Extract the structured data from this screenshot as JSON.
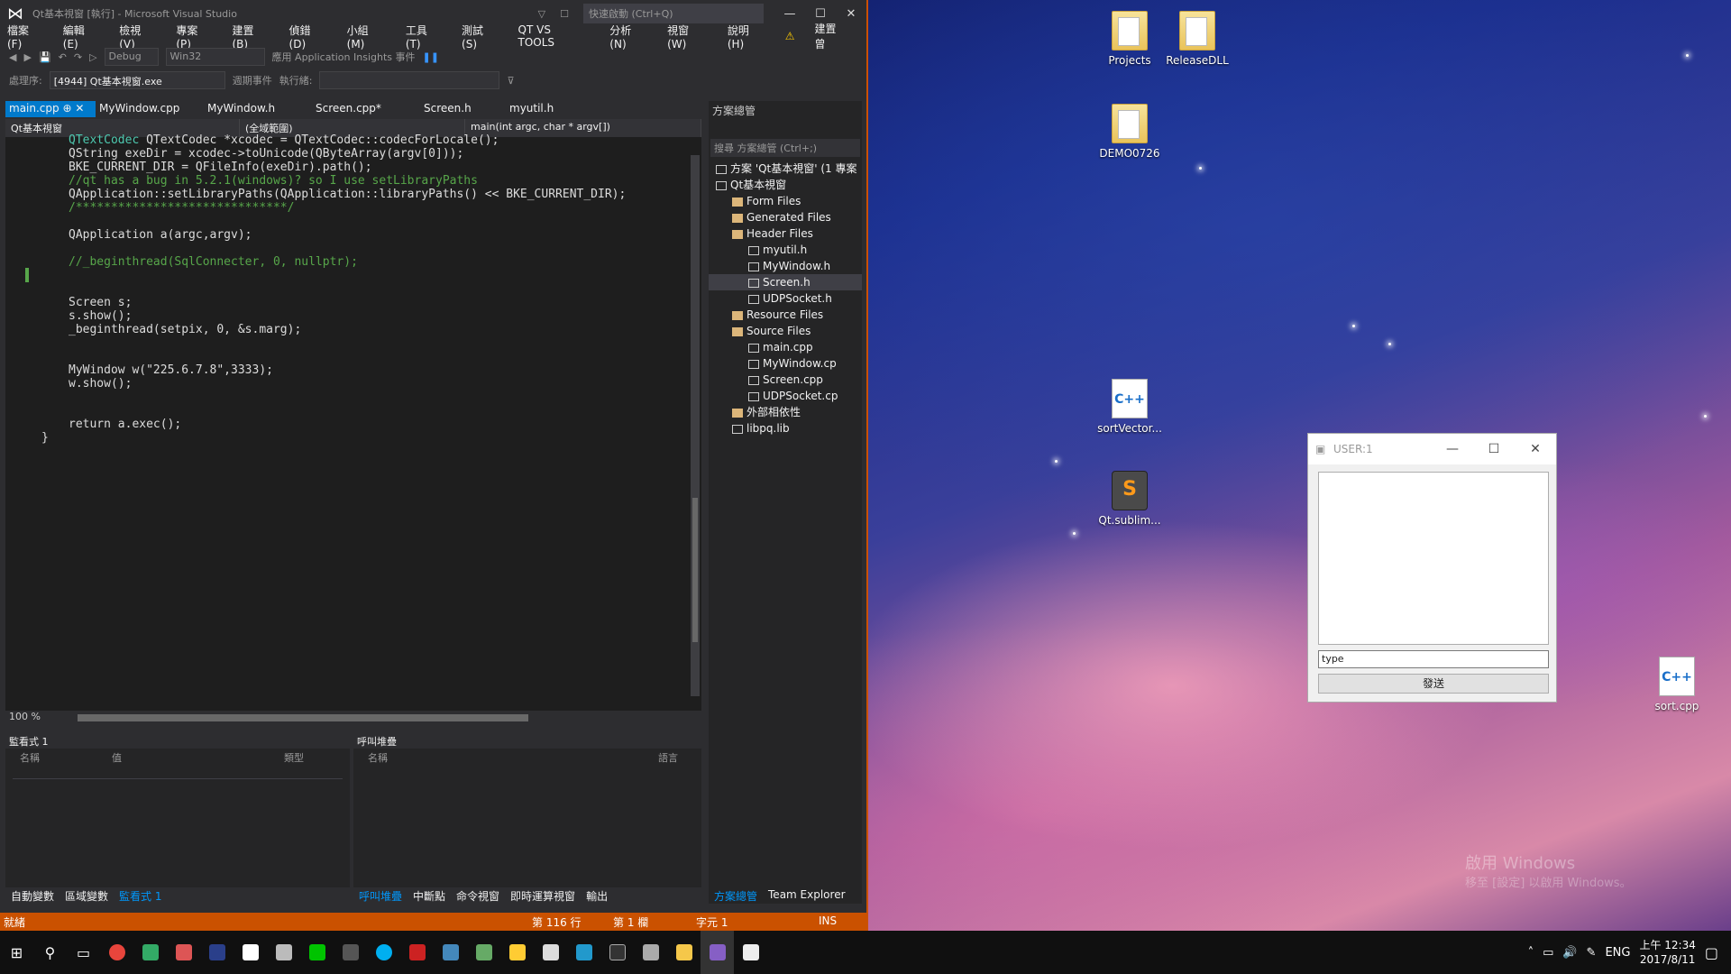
{
  "vs": {
    "title": "Qt基本視窗 [執行] - Microsoft Visual Studio",
    "quick_launch": "快速啟動 (Ctrl+Q)",
    "menu": [
      "檔案(F)",
      "編輯(E)",
      "檢視(V)",
      "專案(P)",
      "建置(B)",
      "偵錯(D)",
      "小組(M)",
      "工具(T)",
      "測試(S)",
      "QT VS TOOLS",
      "分析(N)",
      "視窗(W)",
      "說明(H)",
      "建置曾"
    ],
    "toolbar": {
      "config": "Debug",
      "platform": "Win32",
      "insights": "應用 Application Insights 事件"
    },
    "process_label": "處理序:",
    "process": "[4944] Qt基本視窗.exe",
    "lifecycle": "週期事件",
    "thread_label": "執行緒:",
    "tabs": [
      "main.cpp",
      "MyWindow.cpp",
      "MyWindow.h",
      "Screen.cpp*",
      "Screen.h",
      "myutil.h"
    ],
    "nav": {
      "project": "Qt基本視窗",
      "scope": "(全域範圍)",
      "func": "main(int argc, char * argv[])"
    },
    "code": [
      "QTextCodec *xcodec = QTextCodec::codecForLocale();",
      "QString exeDir = xcodec->toUnicode(QByteArray(argv[0]));",
      "BKE_CURRENT_DIR = QFileInfo(exeDir).path();",
      "//qt has a bug in 5.2.1(windows)? so I use setLibraryPaths",
      "QApplication::setLibraryPaths(QApplication::libraryPaths() << BKE_CURRENT_DIR);",
      "/******************************/",
      "",
      "QApplication a(argc,argv);",
      "",
      "//_beginthread(SqlConnecter, 0, nullptr);",
      "",
      "",
      "Screen s;",
      "s.show();",
      "_beginthread(setpix, 0, &s.marg);",
      "",
      "",
      "MyWindow w(\"225.6.7.8\",3333);",
      "w.show();",
      "",
      "",
      "return a.exec();",
      "}"
    ],
    "zoom": "100 %",
    "solution": {
      "header": "方案總管",
      "search": "搜尋 方案總管 (Ctrl+;)",
      "items": [
        {
          "label": "方案 'Qt基本視窗' (1 專案",
          "level": 0,
          "sel": false
        },
        {
          "label": "Qt基本視窗",
          "level": 0,
          "sel": false
        },
        {
          "label": "Form Files",
          "level": 1,
          "sel": false
        },
        {
          "label": "Generated Files",
          "level": 1,
          "sel": false
        },
        {
          "label": "Header Files",
          "level": 1,
          "sel": false
        },
        {
          "label": "myutil.h",
          "level": 2,
          "sel": false
        },
        {
          "label": "MyWindow.h",
          "level": 2,
          "sel": false
        },
        {
          "label": "Screen.h",
          "level": 2,
          "sel": true
        },
        {
          "label": "UDPSocket.h",
          "level": 2,
          "sel": false
        },
        {
          "label": "Resource Files",
          "level": 1,
          "sel": false
        },
        {
          "label": "Source Files",
          "level": 1,
          "sel": false
        },
        {
          "label": "main.cpp",
          "level": 2,
          "sel": false
        },
        {
          "label": "MyWindow.cp",
          "level": 2,
          "sel": false
        },
        {
          "label": "Screen.cpp",
          "level": 2,
          "sel": false
        },
        {
          "label": "UDPSocket.cp",
          "level": 2,
          "sel": false
        },
        {
          "label": "外部相依性",
          "level": 1,
          "sel": false
        },
        {
          "label": "libpq.lib",
          "level": 1,
          "sel": false
        }
      ],
      "tabs": [
        "方案總管",
        "Team Explorer"
      ]
    },
    "watch": {
      "title": "監看式 1",
      "col_name": "名稱",
      "col_value": "值",
      "col_type": "類型"
    },
    "callstack": {
      "title": "呼叫堆疊",
      "col_name": "名稱",
      "col_lang": "語言"
    },
    "left_tabs": [
      "自動變數",
      "區域變數",
      "監看式 1"
    ],
    "right_tabs": [
      "呼叫堆疊",
      "中斷點",
      "命令視窗",
      "即時運算視窗",
      "輸出"
    ],
    "status": {
      "ready": "就緒",
      "line": "第 116 行",
      "col": "第 1 欄",
      "ch": "字元 1",
      "ins": "INS"
    }
  },
  "desktop": {
    "icons": [
      "Projects",
      "ReleaseDLL",
      "DEMO0726",
      "sortVector...",
      "Qt.sublim...",
      "sort.cpp"
    ],
    "watermark": "啟用 Windows",
    "watermark2": "移至 [設定] 以啟用 Windows。"
  },
  "dialog": {
    "title": "USER:1",
    "input": "type",
    "button": "發送"
  },
  "taskbar": {
    "lang": "ENG",
    "time": "上午 12:34",
    "date": "2017/8/11"
  }
}
